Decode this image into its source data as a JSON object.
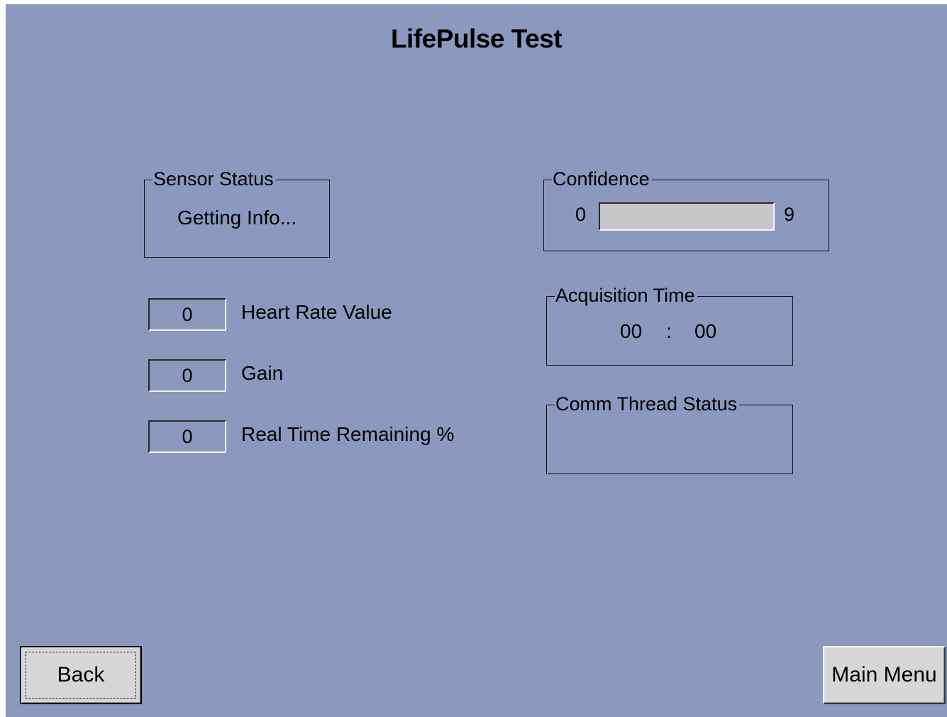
{
  "title": "LifePulse Test",
  "sensor_status": {
    "legend": "Sensor Status",
    "value": "Getting Info..."
  },
  "readings": [
    {
      "value": "0",
      "label": "Heart Rate Value"
    },
    {
      "value": "0",
      "label": "Gain"
    },
    {
      "value": "0",
      "label": "Real Time Remaining %"
    }
  ],
  "confidence": {
    "legend": "Confidence",
    "min": "0",
    "max": "9",
    "level": 0
  },
  "acquisition_time": {
    "legend": "Acquisition Time",
    "minutes": "00",
    "separator": ":",
    "seconds": "00"
  },
  "comm_thread_status": {
    "legend": "Comm Thread Status",
    "value": ""
  },
  "buttons": {
    "back": "Back",
    "main_menu": "Main Menu"
  },
  "colors": {
    "background": "#8a99bd",
    "button_face": "#d6d6d6",
    "progress_track": "#c6c6c8"
  }
}
